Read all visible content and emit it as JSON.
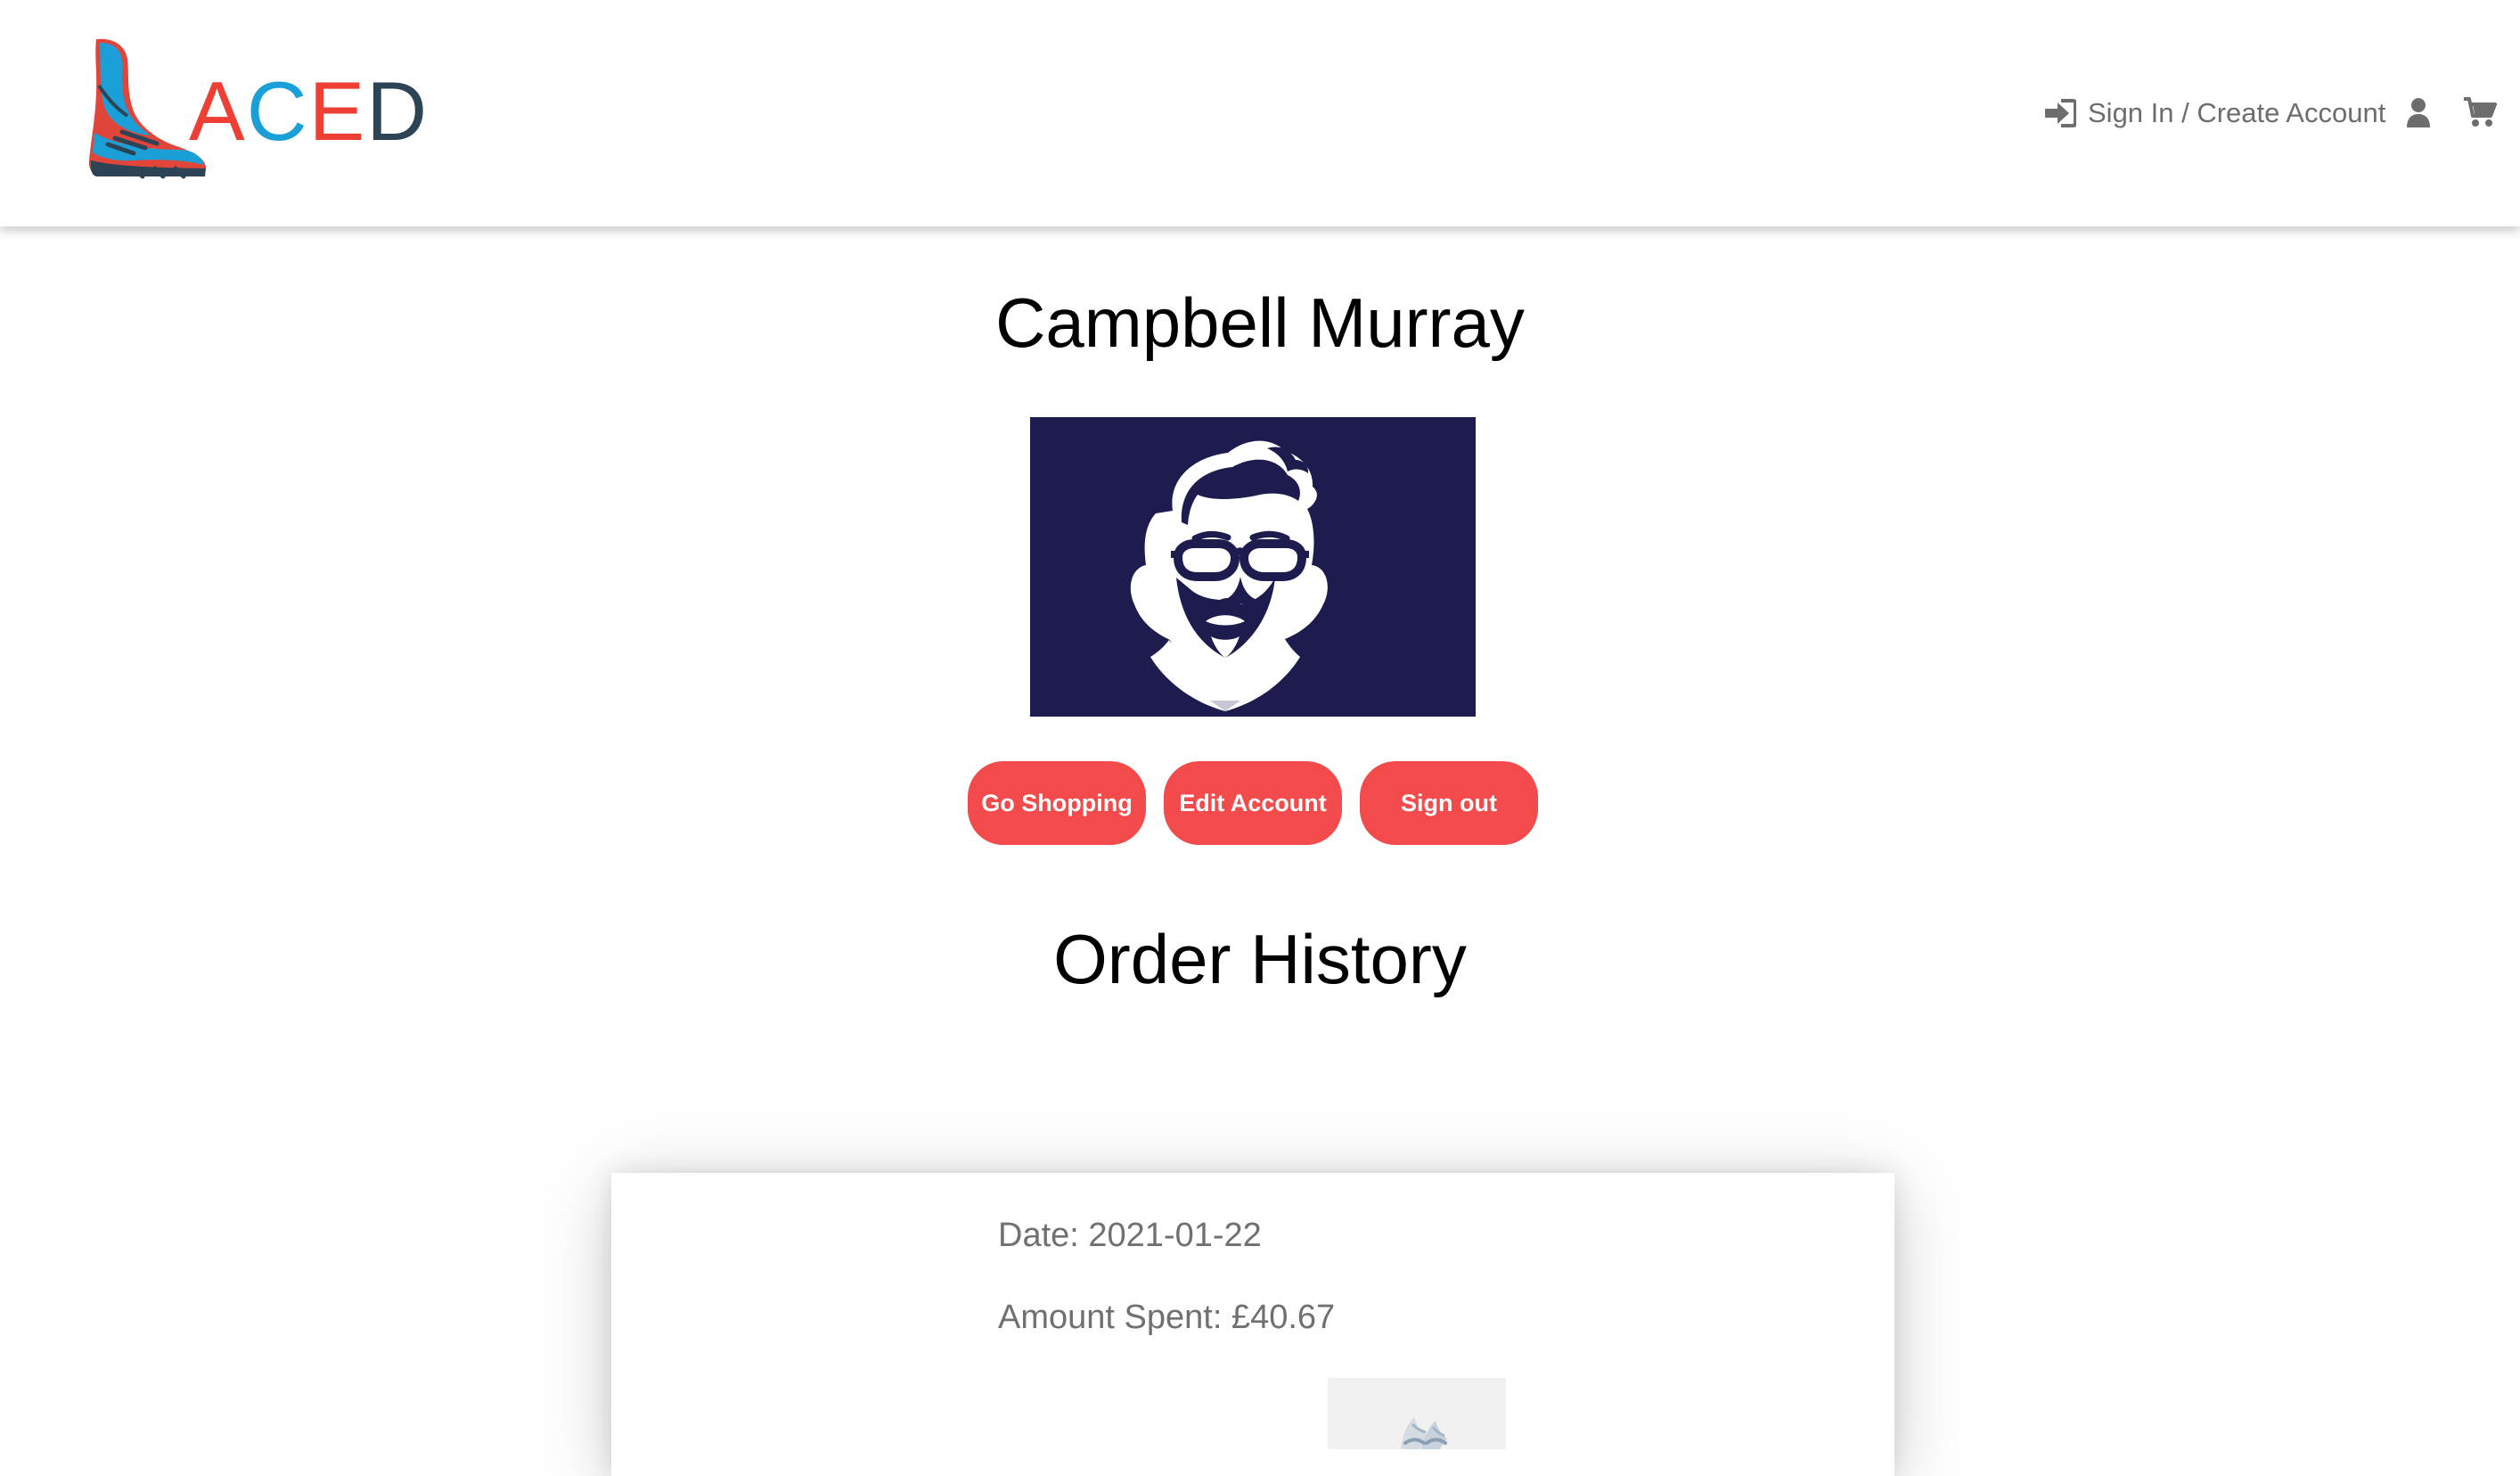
{
  "header": {
    "logo_letters": [
      "A",
      "C",
      "E",
      "D"
    ],
    "signin_label": "Sign In / Create Account",
    "signin_icon": "sign-in-icon",
    "user_icon": "user-icon",
    "cart_icon": "cart-icon"
  },
  "profile": {
    "name": "Campbell Murray",
    "avatar_icon": "bearded-man-with-glasses-avatar",
    "buttons": {
      "shop": "Go Shopping",
      "edit": "Edit Account",
      "signout": "Sign out"
    }
  },
  "orders": {
    "title": "Order History",
    "items": [
      {
        "date_text": "Date: 2021-01-22",
        "amount_text": "Amount Spent: £40.67",
        "thumbnail_icon": "product-thumbnail-icon"
      }
    ]
  },
  "colors": {
    "accent_red": "#f34a4b",
    "logo_red": "#ed3f34",
    "logo_blue": "#1aa0d7",
    "logo_dark": "#2d4457",
    "avatar_bg": "#1e1c4e",
    "nav_text": "#6d6d6d"
  }
}
